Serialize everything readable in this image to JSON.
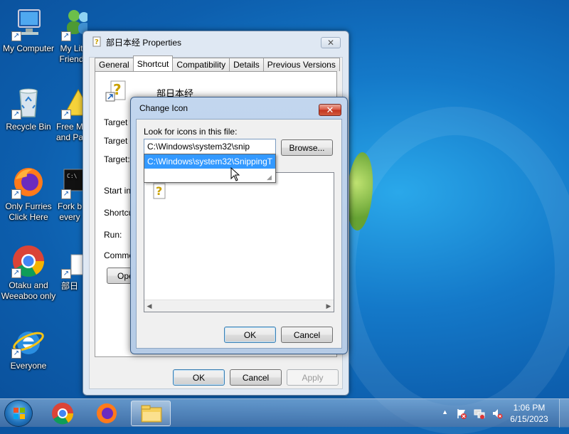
{
  "desktop": {
    "icons": [
      {
        "label": "My Computer"
      },
      {
        "label": "My Lit Friend"
      },
      {
        "label": "Recycle Bin"
      },
      {
        "label": "Free M and Pa"
      },
      {
        "label": "Only Furries Click Here"
      },
      {
        "label": "Fork b every"
      },
      {
        "label": "Otaku and Weeaboo only"
      },
      {
        "label": "部日"
      },
      {
        "label": "Everyone"
      }
    ]
  },
  "properties_window": {
    "title": "部日本经 Properties",
    "close_glyph": "✕",
    "tabs": [
      "General",
      "Shortcut",
      "Compatibility",
      "Details",
      "Previous Versions"
    ],
    "active_tab": "Shortcut",
    "shortcut_name": "部日本经",
    "fields": [
      "Target t",
      "Target lo",
      "Target:",
      "Start in:",
      "Shortcut",
      "Run:",
      "Commen"
    ],
    "open_button_label": "Ope",
    "buttons": {
      "ok": "OK",
      "cancel": "Cancel",
      "apply": "Apply"
    }
  },
  "change_icon_dialog": {
    "title": "Change Icon",
    "close_glyph": "✕",
    "look_label": "Look for icons in this file:",
    "path_value": "C:\\Windows\\system32\\snip",
    "browse_label": "Browse...",
    "autocomplete_item": "C:\\Windows\\system32\\SnippingT",
    "buttons": {
      "ok": "OK",
      "cancel": "Cancel"
    }
  },
  "taskbar": {
    "pinned": [
      "chrome-icon",
      "firefox-icon",
      "explorer-icon"
    ],
    "tray_arrow": "▲",
    "time": "1:06 PM",
    "date": "6/15/2023"
  },
  "colors": {
    "selection": "#3399ff",
    "close_red": "#c2341f"
  }
}
